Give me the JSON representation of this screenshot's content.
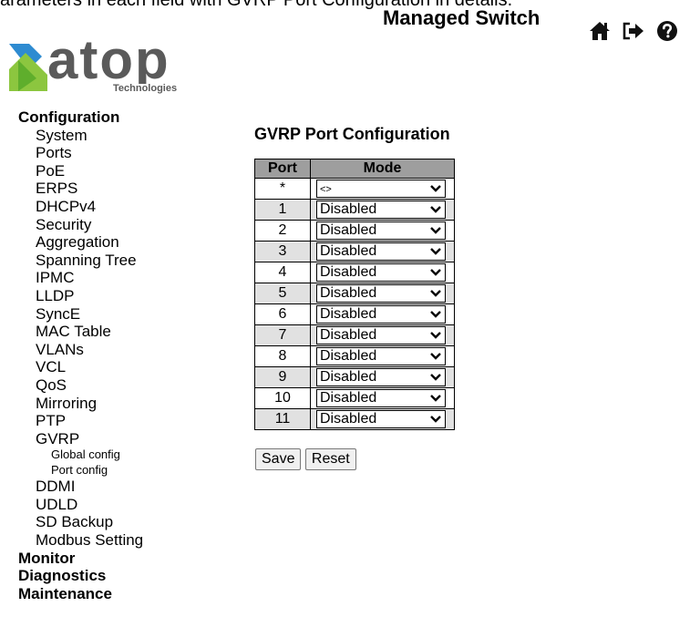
{
  "cutoff_text": "arameters in each field with GVRP Port Configuration in details.",
  "header": {
    "title": "Managed Switch",
    "icons": [
      "home-icon",
      "logout-icon",
      "help-icon"
    ]
  },
  "logo": {
    "word": "atop",
    "sub": "Technologies"
  },
  "menu": {
    "configuration": "Configuration",
    "config_items": [
      "System",
      "Ports",
      "PoE",
      "ERPS",
      "DHCPv4",
      "Security",
      "Aggregation",
      "Spanning Tree",
      "IPMC",
      "LLDP",
      "SyncE",
      "MAC Table",
      "VLANs",
      "VCL",
      "QoS",
      "Mirroring",
      "PTP",
      "GVRP"
    ],
    "gvrp_subitems": [
      "Global config",
      "Port config"
    ],
    "config_items_after": [
      "DDMI",
      "UDLD",
      "SD Backup",
      "Modbus Setting"
    ],
    "monitor": "Monitor",
    "diagnostics": "Diagnostics",
    "maintenance": "Maintenance"
  },
  "page": {
    "title": "GVRP Port Configuration"
  },
  "table": {
    "headers": {
      "port": "Port",
      "mode": "Mode"
    },
    "rows": [
      {
        "port": "*",
        "mode": "<>"
      },
      {
        "port": "1",
        "mode": "Disabled"
      },
      {
        "port": "2",
        "mode": "Disabled"
      },
      {
        "port": "3",
        "mode": "Disabled"
      },
      {
        "port": "4",
        "mode": "Disabled"
      },
      {
        "port": "5",
        "mode": "Disabled"
      },
      {
        "port": "6",
        "mode": "Disabled"
      },
      {
        "port": "7",
        "mode": "Disabled"
      },
      {
        "port": "8",
        "mode": "Disabled"
      },
      {
        "port": "9",
        "mode": "Disabled"
      },
      {
        "port": "10",
        "mode": "Disabled"
      },
      {
        "port": "11",
        "mode": "Disabled"
      }
    ]
  },
  "buttons": {
    "save": "Save",
    "reset": "Reset"
  },
  "colors": {
    "logo_blue": "#2e8bd1",
    "logo_green": "#8cc63f",
    "logo_gray": "#5a5a5a",
    "table_header_bg": "#9e9e9e",
    "row_alt_bg": "#e1e1e1"
  }
}
